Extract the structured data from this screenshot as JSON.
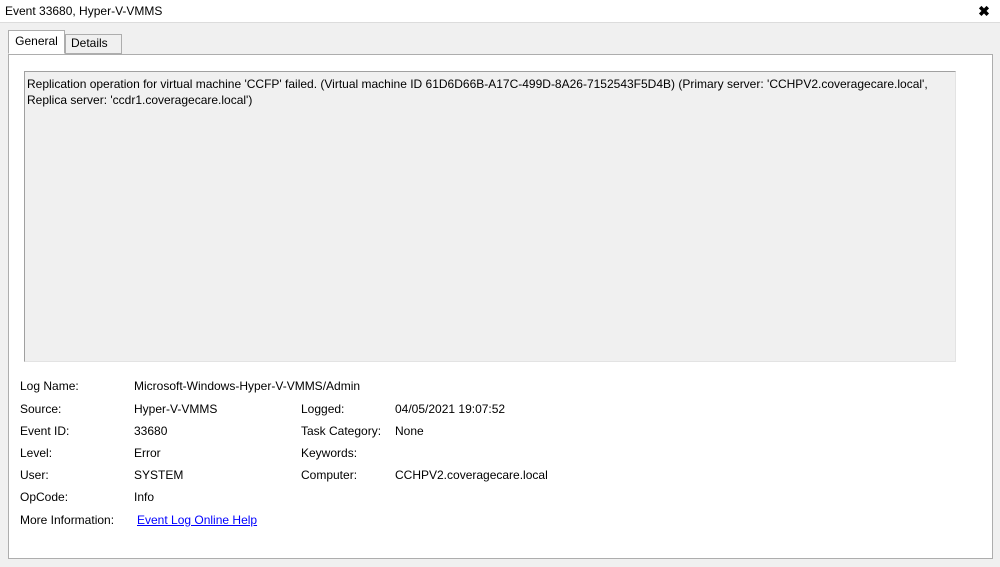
{
  "window": {
    "title": "Event 33680, Hyper-V-VMMS",
    "close_glyph": "✖"
  },
  "tabs": [
    {
      "label": "General",
      "active": true
    },
    {
      "label": "Details",
      "active": false
    }
  ],
  "description": {
    "line1": "Replication operation for virtual machine 'CCFP' failed. (Virtual machine ID 61D6D66B-A17C-499D-8A26-7152543F5D4B) (Primary server: 'CCHPV2.coveragecare.local',",
    "line2": "Replica server: 'ccdr1.coveragecare.local')"
  },
  "properties": {
    "log_name_label": "Log Name:",
    "log_name_value": "Microsoft-Windows-Hyper-V-VMMS/Admin",
    "source_label": "Source:",
    "source_value": "Hyper-V-VMMS",
    "logged_label": "Logged:",
    "logged_value": "04/05/2021 19:07:52",
    "event_id_label": "Event ID:",
    "event_id_value": "33680",
    "task_category_label": "Task Category:",
    "task_category_value": "None",
    "level_label": "Level:",
    "level_value": "Error",
    "keywords_label": "Keywords:",
    "keywords_value": "",
    "user_label": "User:",
    "user_value": "SYSTEM",
    "computer_label": "Computer:",
    "computer_value": "CCHPV2.coveragecare.local",
    "opcode_label": "OpCode:",
    "opcode_value": "Info",
    "more_info_label": "More Information:",
    "more_info_link": "Event Log Online Help"
  }
}
